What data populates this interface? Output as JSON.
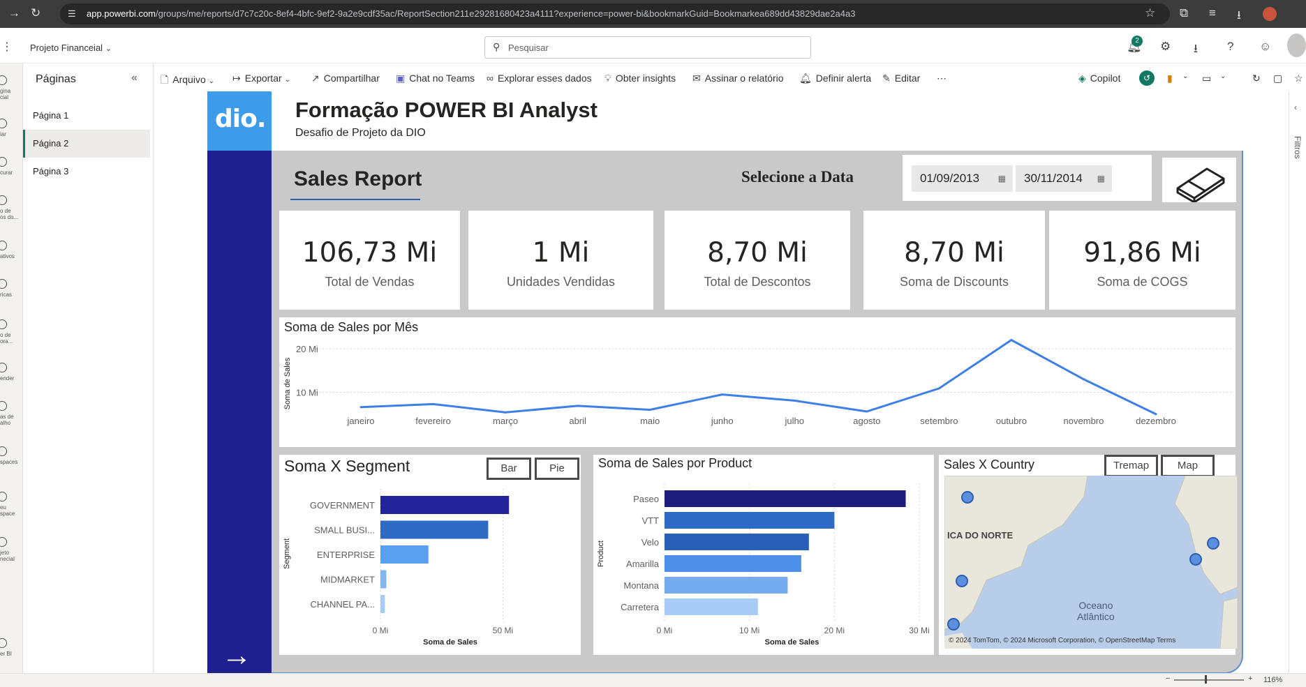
{
  "browser": {
    "url_host": "app.powerbi.com",
    "url_rest": "/groups/me/reports/d7c7c20c-8ef4-4bfc-9ef2-9a2e9cdf35ac/ReportSection211e29281680423a4111?experience=power-bi&bookmarkGuid=Bookmarkea689dd43829dae2a4a3"
  },
  "header": {
    "workspace": "Projeto Financeial",
    "search_placeholder": "Pesquisar",
    "notification_count": "2"
  },
  "left_rail": [
    {
      "label": "gina\ncial"
    },
    {
      "label": "iar"
    },
    {
      "label": "curar"
    },
    {
      "label": "o de\nos do..."
    },
    {
      "label": "ativos"
    },
    {
      "label": "ricas"
    },
    {
      "label": "o de\nora..."
    },
    {
      "label": "ender"
    },
    {
      "label": "as de\nalho"
    },
    {
      "label": "spaces"
    },
    {
      "label": "eu\nspace"
    },
    {
      "label": "jeto\nnecial"
    },
    {
      "label": "er BI"
    }
  ],
  "pages_panel": {
    "title": "Páginas",
    "pages": [
      "Página 1",
      "Página 2",
      "Página 3"
    ],
    "active_index": 1
  },
  "toolbar": {
    "items": [
      "Arquivo",
      "Exportar",
      "Compartilhar",
      "Chat no Teams",
      "Explorar esses dados",
      "Obter insights",
      "Assinar o relatório",
      "Definir alerta",
      "Editar"
    ],
    "copilot": "Copilot"
  },
  "filters_label": "Filtros",
  "report": {
    "logo": "dio.",
    "title": "Formação POWER BI Analyst",
    "subtitle": "Desafio de Projeto da DIO",
    "section_title": "Sales Report",
    "date_label": "Selecione a Data",
    "date_start": "01/09/2013",
    "date_end": "30/11/2014",
    "cards": [
      {
        "value": "106,73 Mi",
        "label": "Total de Vendas"
      },
      {
        "value": "1 Mi",
        "label": "Unidades Vendidas"
      },
      {
        "value": "8,70 Mi",
        "label": "Total de Descontos"
      },
      {
        "value": "8,70 Mi",
        "label": "Soma de Discounts"
      },
      {
        "value": "91,86 Mi",
        "label": "Soma de COGS"
      }
    ],
    "segment_panel": {
      "title": "Soma X Segment",
      "btn_bar": "Bar",
      "btn_pie": "Pie"
    },
    "product_panel": {
      "title": "Soma de Sales por Product"
    },
    "country_panel": {
      "title": "Sales X Country",
      "btn_tremap": "Tremap",
      "btn_map": "Map",
      "label_na": "ICA DO NORTE",
      "label_ocean_1": "Oceano",
      "label_ocean_2": "Atlântico",
      "attribution": "© 2024 TomTom, © 2024 Microsoft Corporation, © OpenStreetMap  Terms"
    }
  },
  "footer": {
    "zoom": "116%"
  },
  "colors": {
    "nav_blue": "#1f1f8f",
    "logo_blue": "#3d9bea",
    "line_blue": "#3d7fe6",
    "bar_dark": "#23239a",
    "bar_mid": "#2e6ac4",
    "bar_light": "#5aa0f0"
  },
  "chart_data": [
    {
      "type": "line",
      "title": "Soma de Sales por Mês",
      "ylabel": "Soma de Sales",
      "x": [
        "janeiro",
        "fevereiro",
        "março",
        "abril",
        "maio",
        "junho",
        "julho",
        "agosto",
        "setembro",
        "outubro",
        "novembro",
        "dezembro"
      ],
      "values": [
        6.6,
        7.3,
        5.4,
        6.9,
        6.0,
        9.5,
        8.1,
        5.6,
        10.9,
        22.0,
        13.0,
        5.0
      ],
      "y_ticks": [
        "10 Mi",
        "20 Mi"
      ],
      "ylim": [
        0,
        24
      ],
      "grid": true
    },
    {
      "type": "bar",
      "orientation": "horizontal",
      "title": "Soma X Segment",
      "ylabel": "Segment",
      "xlabel": "Soma de Sales",
      "categories": [
        "GOVERNMENT",
        "SMALL BUSI...",
        "ENTERPRISE",
        "MIDMARKET",
        "CHANNEL PA..."
      ],
      "values": [
        52.5,
        44.0,
        19.6,
        2.4,
        1.8
      ],
      "x_ticks": [
        "0 Mi",
        "50 Mi"
      ],
      "xlim": [
        0,
        57
      ],
      "colors": [
        "#23239a",
        "#2e6ac4",
        "#5aa0f0",
        "#7fb6f5",
        "#a5cbf7"
      ]
    },
    {
      "type": "bar",
      "orientation": "horizontal",
      "title": "Soma de Sales por Product",
      "ylabel": "Product",
      "xlabel": "Soma de Sales",
      "categories": [
        "Paseo",
        "VTT",
        "Velo",
        "Amarilla",
        "Montana",
        "Carretera"
      ],
      "values": [
        28.4,
        20.0,
        17.0,
        16.1,
        14.5,
        11.0
      ],
      "x_ticks": [
        "0 Mi",
        "10 Mi",
        "20 Mi",
        "30 Mi"
      ],
      "xlim": [
        0,
        30
      ],
      "colors": [
        "#1c1c7a",
        "#2e6ac4",
        "#2a5fb8",
        "#4d8fe8",
        "#73aaf0",
        "#a8cbf7"
      ]
    }
  ]
}
